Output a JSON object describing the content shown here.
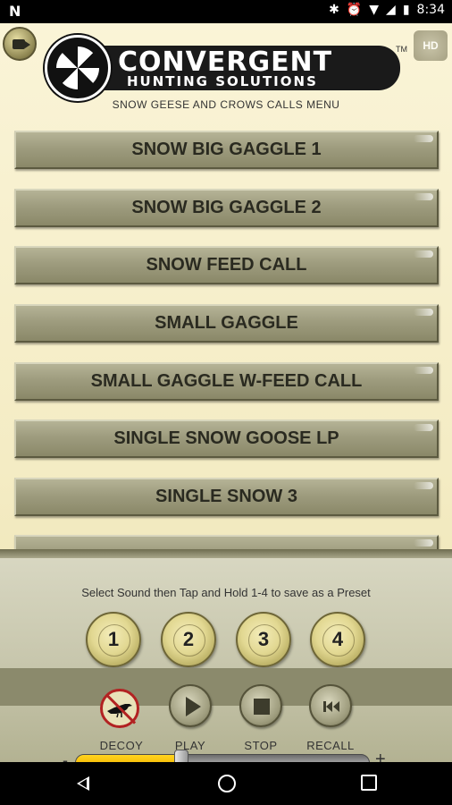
{
  "status_bar": {
    "left_icon": "notification-n-icon",
    "icons": [
      "bluetooth-icon",
      "alarm-icon",
      "wifi-icon",
      "signal-icon",
      "battery-icon"
    ],
    "time": "8:34"
  },
  "header": {
    "logo_line1": "CONVERGENT",
    "logo_line2": "HUNTING SOLUTIONS",
    "trademark": "TM",
    "hd_badge": "HD",
    "subtitle": "SNOW GEESE AND CROWS CALLS MENU"
  },
  "sounds": [
    {
      "label": "SNOW BIG GAGGLE 1"
    },
    {
      "label": "SNOW BIG GAGGLE 2"
    },
    {
      "label": "SNOW FEED CALL"
    },
    {
      "label": "SMALL GAGGLE"
    },
    {
      "label": "SMALL GAGGLE W-FEED CALL"
    },
    {
      "label": "SINGLE SNOW GOOSE LP"
    },
    {
      "label": "SINGLE SNOW 3"
    }
  ],
  "panel": {
    "hint": "Select Sound then Tap and Hold 1-4 to save as a Preset",
    "presets": [
      "1",
      "2",
      "3",
      "4"
    ],
    "controls": {
      "decoy": "DECOY",
      "play": "PLAY",
      "stop": "STOP",
      "recall": "RECALL"
    },
    "volume": {
      "minus": "-",
      "plus": "+",
      "level": 0.36
    }
  },
  "colors": {
    "accent": "#f5b800",
    "background": "#f4ecc4",
    "button": "#9e9c7e"
  }
}
